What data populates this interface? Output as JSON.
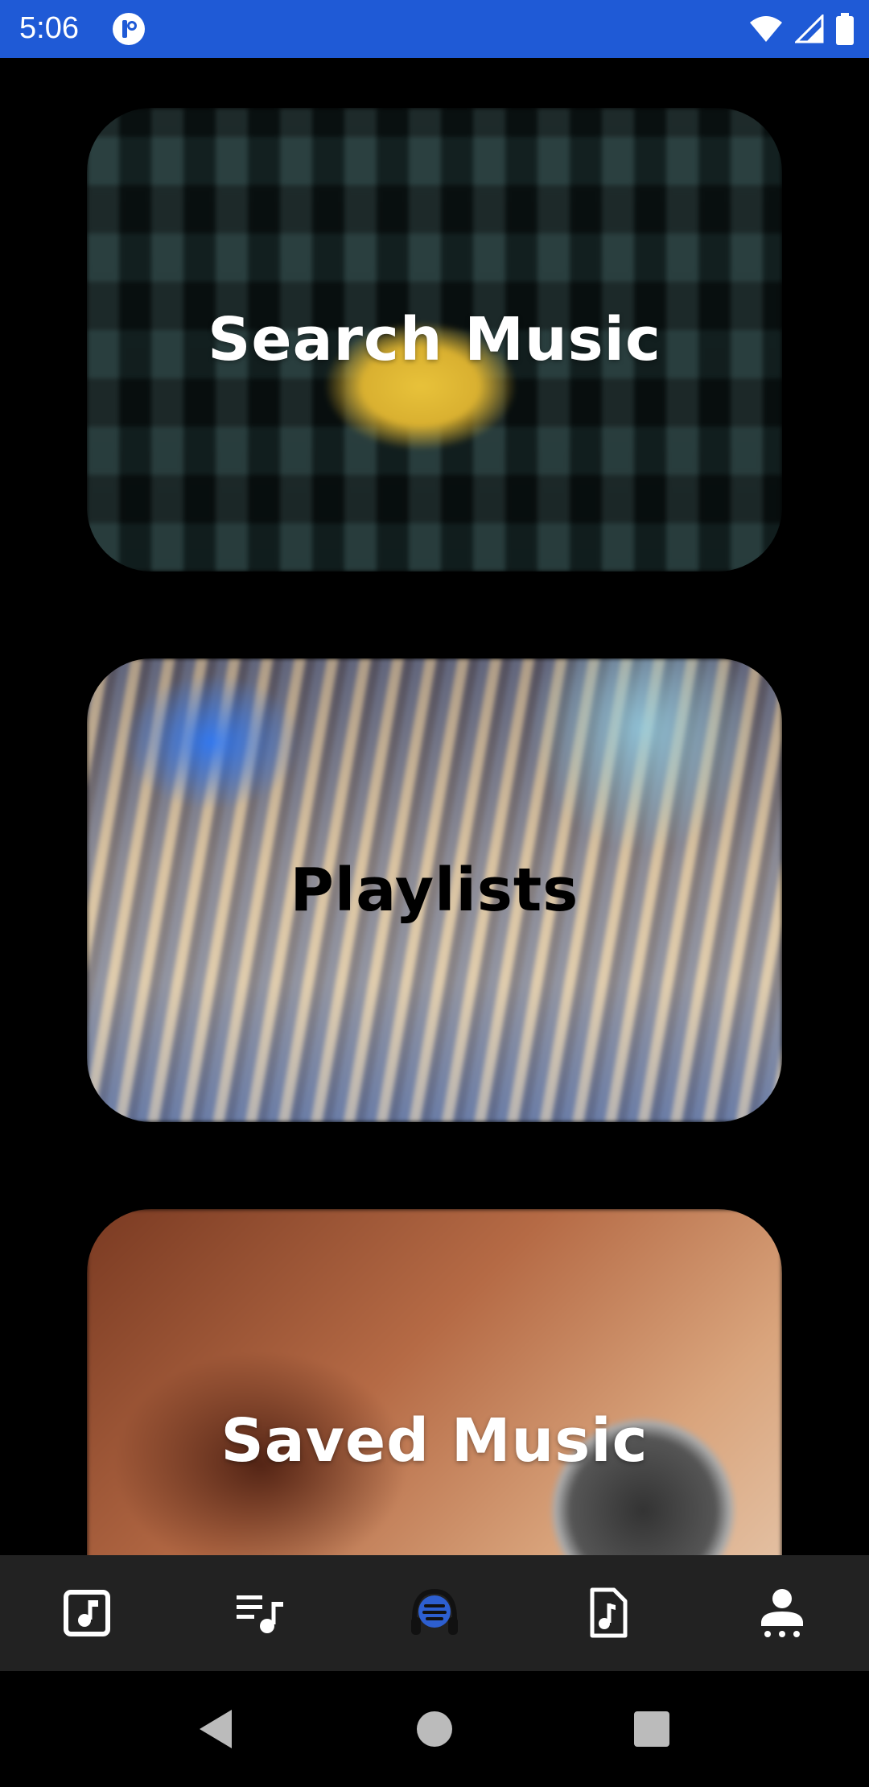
{
  "status_bar": {
    "time": "5:06",
    "background": "#1f5ad6",
    "icons": [
      "app-notification-icon",
      "wifi-icon",
      "cell-signal-icon",
      "battery-icon"
    ]
  },
  "cards": [
    {
      "label": "Search Music",
      "label_color": "#ffffff"
    },
    {
      "label": "Playlists",
      "label_color": "#000000"
    },
    {
      "label": "Saved Music",
      "label_color": "#ffffff"
    }
  ],
  "bottom_nav": {
    "background": "#222222",
    "items": [
      {
        "icon": "music-note-box-icon"
      },
      {
        "icon": "playlist-music-icon"
      },
      {
        "icon": "headphones-logo-icon",
        "selected": true
      },
      {
        "icon": "music-file-icon"
      },
      {
        "icon": "account-icon"
      }
    ]
  },
  "system_nav": {
    "buttons": [
      "back-icon",
      "home-icon",
      "recents-icon"
    ]
  }
}
